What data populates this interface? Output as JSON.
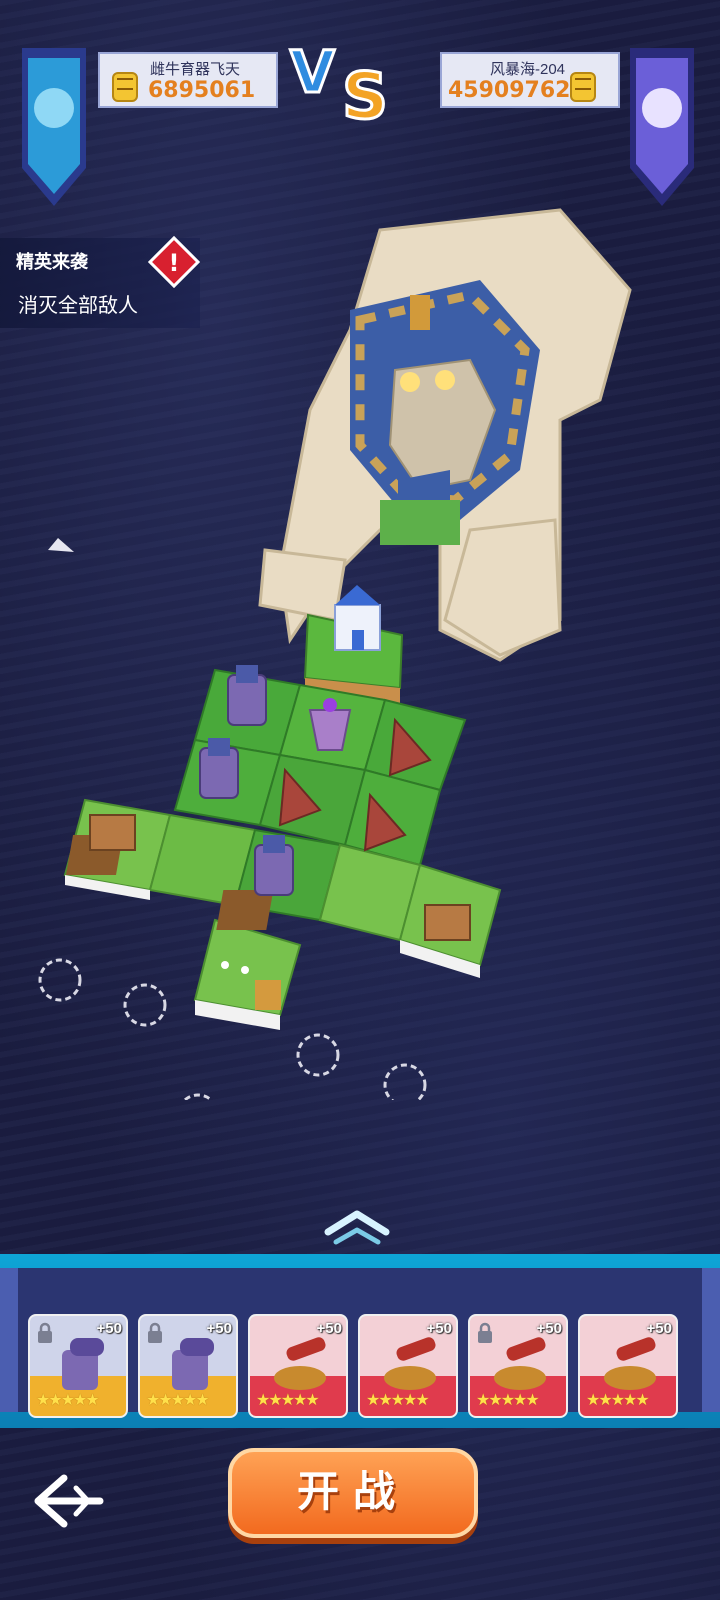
{
  "players": {
    "left": {
      "name": "雌牛育器飞天",
      "score": "6895061"
    },
    "right": {
      "name": "风暴海-204",
      "score": "45909762"
    },
    "vs_label": "VS"
  },
  "quest": {
    "title": "精英来袭",
    "description": "消灭全部敌人",
    "alert_glyph": "!"
  },
  "dock": {
    "cards": [
      {
        "plus": "+50",
        "stars": "★★★★★",
        "locked": true,
        "type": "cannon"
      },
      {
        "plus": "+50",
        "stars": "★★★★★",
        "locked": true,
        "type": "cannon"
      },
      {
        "plus": "+50",
        "stars": "★★★★★",
        "locked": false,
        "type": "ballista"
      },
      {
        "plus": "+50",
        "stars": "★★★★★",
        "locked": false,
        "type": "ballista"
      },
      {
        "plus": "+50",
        "stars": "★★★★★",
        "locked": true,
        "type": "ballista"
      },
      {
        "plus": "+50",
        "stars": "★★★★★",
        "locked": false,
        "type": "ballista"
      }
    ]
  },
  "actions": {
    "start_label": "开战"
  },
  "colors": {
    "accent_orange": "#f26a1f",
    "dock_cyan": "#0ea5d6",
    "alert_red": "#d8202f"
  }
}
